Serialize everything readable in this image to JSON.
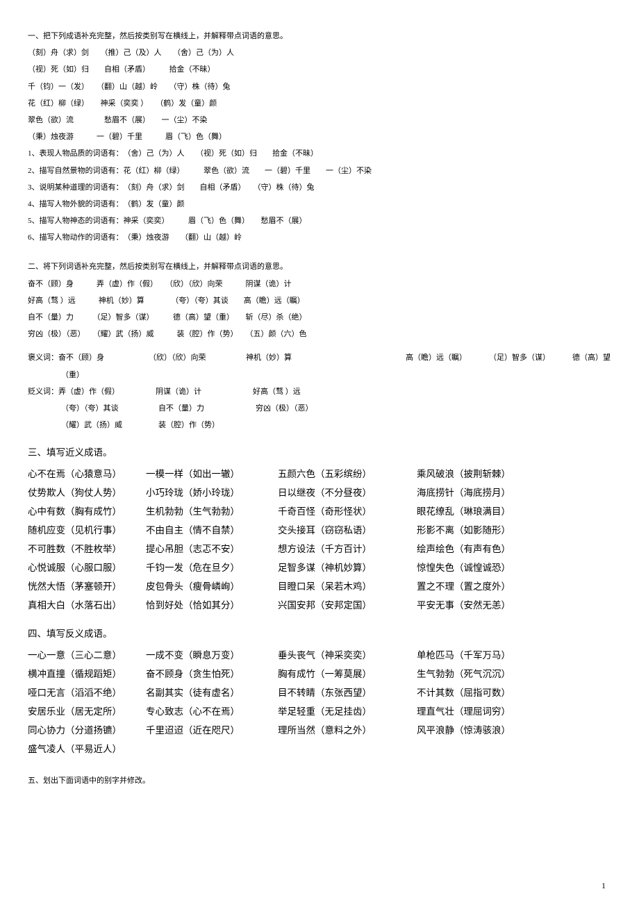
{
  "s1": {
    "title": "一、把下列成语补充完整，然后按类别写在横线上，并解释带点词语的意思。",
    "lines": [
      "（刻）舟（求）剑　　（推）己（及）人　　（舍）己（为）人",
      "（视）死（如）归　　自相（矛盾）　　　拾金（不昧）",
      "千（钧）一（发）　　（翻）山（越）岭　　（守）株（待）兔",
      "花（红）柳（绿）　　神采（奕奕  ）　　（鹤）发（童）颜",
      "翠色（欲）流　　　　愁眉不（展）　　一（尘）不染",
      "（秉）烛夜游　　　一（碧）千里　　　眉（飞）色（舞）"
    ],
    "cats": [
      "1、表现人物品质的词语有：　（舍）己（为）人　　（视）死（如）归　　拾金（不昧）",
      "2、描写自然景物的词语有：花（红）柳（绿）　　　翠色（欲）流　　一（碧）千里　　一（尘）不染",
      "3、说明某种道理的词语有：　（刻）舟（求）剑　　自相（矛盾）　　（守）株（待）兔",
      "4、描写人物外貌的词语有：　（鹤）发（童）颜",
      "5、描写人物神态的词语有：神采（奕奕）　　　眉（飞）色（舞）　　愁眉不（展）",
      "6、描写人物动作的词语有：　（秉）烛夜游　　（翻）山（越）岭"
    ]
  },
  "s2": {
    "title": "二、将下列词语补充完整，然后按类别写在横线上，并解释带点词语的意思。",
    "lines": [
      "奋不（顾）身　　　弄（虚）作（假）　　（欣）（欣）向荣　　　阴谋（诡）计",
      "好高（骛  ）远　　　神机（妙）算　　　　（夸）（夸）其谈　　高（瞻）远（瞩）",
      "自不（量）力　　　（足）智多（谋）　　　德（高）望（重）　　斩（尽）杀（绝）",
      "穷凶（极）（恶）　　（耀）武（扬）威　　　装（腔）作（势）　　（五）颜（六）色"
    ],
    "good_label": "褒义词：",
    "good_a": "奋不（顾）身",
    "good_b": "（欣）（欣）向荣",
    "good_c": "神机（妙）算",
    "good_d": "高（瞻）远（瞩）",
    "good_e": "（足）智多（谋）",
    "good_f": "德（高）望",
    "good_cont": "（重）",
    "bad_label": "贬义词：",
    "bad1a": "弄（虚）作（假）",
    "bad1b": "阴谋（诡）计",
    "bad1c": "好高（骛  ）远",
    "bad2a": "（夸）（夸）其谈",
    "bad2b": "自不（量）力",
    "bad2c": "穷凶（极）（恶）",
    "bad3a": "（耀）武（扬）威",
    "bad3b": "装（腔）作（势）"
  },
  "s3": {
    "title": "三、填写近义成语。",
    "rows": [
      [
        "心不在焉（心猿意马）",
        "一模一样（如出一辙）",
        "五颜六色（五彩缤纷）",
        "乘风破浪（披荆斩棘）"
      ],
      [
        "仗势欺人（狗仗人势）",
        "小巧玲珑（娇小玲珑）",
        "日以继夜（不分昼夜）",
        "海底捞针（海底捞月）"
      ],
      [
        "心中有数（胸有成竹）",
        "生机勃勃（生气勃勃）",
        "千奇百怪（奇形怪状）",
        "眼花缭乱（琳琅满目）"
      ],
      [
        "随机应变（见机行事）",
        "不由自主（情不自禁）",
        "交头接耳（窃窃私语）",
        "形影不离（如影随形）"
      ],
      [
        "不可胜数（不胜枚举）",
        "提心吊胆（志忑不安）",
        "想方设法（千方百计）",
        "绘声绘色（有声有色）"
      ],
      [
        "心悦诚服（心服口服）",
        "千钧一发（危在旦夕）",
        "足智多谋（神机妙算）",
        "惊惶失色（诚惶诚恐）"
      ],
      [
        "恍然大悟（茅塞顿开）",
        "皮包骨头（瘦骨嶙峋）",
        "目瞪口呆（呆若木鸡）",
        "置之不理（置之度外）"
      ],
      [
        "真相大白（水落石出）",
        "恰到好处（恰如其分）",
        "兴国安邦（安邦定国）",
        "平安无事（安然无恙）"
      ]
    ]
  },
  "s4": {
    "title": "四、填写反义成语。",
    "rows": [
      [
        "一心一意（三心二意）",
        "一成不变（瞬息万变）",
        "垂头丧气（神采奕奕）",
        "单枪匹马（千军万马）"
      ],
      [
        "  横冲直撞（循规蹈矩）",
        "奋不顾身（贪生怕死）",
        "胸有成竹（一筹莫展）",
        "生气勃勃（死气沉沉）"
      ],
      [
        "哑口无言（滔滔不绝）",
        "名副其实（徒有虚名）",
        "目不转睛（东张西望）",
        "不计其数（屈指可数）"
      ],
      [
        "安居乐业（居无定所）",
        "专心致志（心不在焉）",
        "举足轻重（无足挂齿）",
        "理直气壮（理屈词穷）"
      ],
      [
        "同心协力（分道扬镳）",
        "千里迢迢（近在咫尺）",
        "理所当然（意料之外）",
        "风平浪静（惊涛骇浪）"
      ],
      [
        "盛气凌人（平易近人）",
        "",
        "",
        ""
      ]
    ]
  },
  "s5": {
    "title": "五、划出下面词语中的别字并修改。"
  },
  "page": "1"
}
